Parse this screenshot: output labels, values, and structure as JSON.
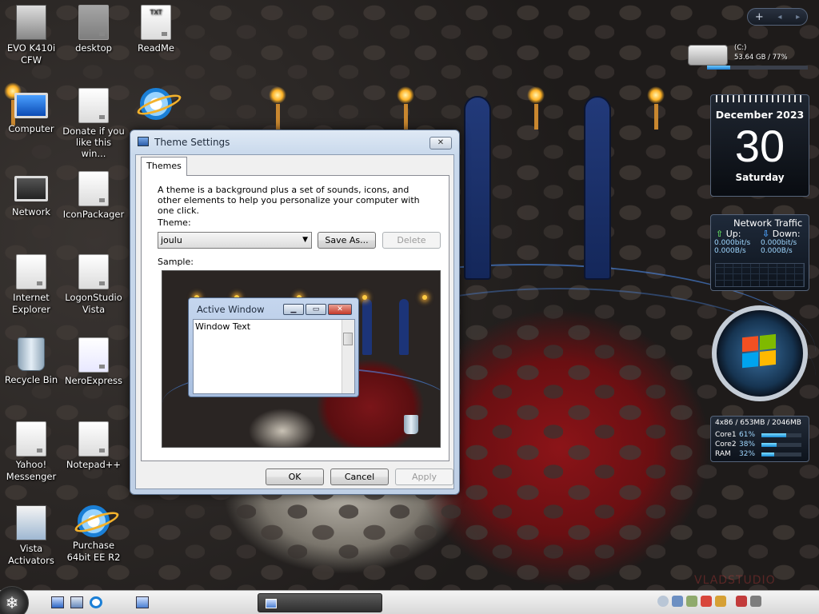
{
  "desktop_icons": [
    {
      "label": "EVO K410i\nCFW"
    },
    {
      "label": "desktop"
    },
    {
      "label": "ReadMe",
      "badge": "TXT"
    },
    {
      "label": "Computer"
    },
    {
      "label": "Donate if you like this win..."
    },
    {
      "label": "Network"
    },
    {
      "label": "IconPackager"
    },
    {
      "label": "Internet Explorer"
    },
    {
      "label": "LogonStudio Vista"
    },
    {
      "label": "Recycle Bin"
    },
    {
      "label": "NeroExpress"
    },
    {
      "label": "Yahoo! Messenger"
    },
    {
      "label": "Notepad++"
    },
    {
      "label": "Vista Activators"
    },
    {
      "label": "Purchase 64bit EE R2"
    }
  ],
  "gadget_toolbar": {
    "add": "+",
    "prev": "◂",
    "next": "▸"
  },
  "drive_gadget": {
    "name": "(C:)",
    "info": "53.64 GB / 77%",
    "used_fraction": 0.23
  },
  "calendar": {
    "month": "December 2023",
    "day": "30",
    "weekday": "Saturday"
  },
  "network": {
    "title": "Network Traffic",
    "up_label": "Up:",
    "down_label": "Down:",
    "up_bits": "0.000bit/s",
    "down_bits": "0.000bit/s",
    "up_bytes": "0.000B/s",
    "down_bytes": "0.000B/s"
  },
  "system_monitor": {
    "header": "4x86 / 653MB / 2046MB",
    "rows": [
      {
        "name": "Core1",
        "percent": "61%",
        "value": 0.61
      },
      {
        "name": "Core2",
        "percent": "38%",
        "value": 0.38
      },
      {
        "name": "RAM",
        "percent": "32%",
        "value": 0.32
      }
    ]
  },
  "dialog": {
    "title": "Theme Settings",
    "close": "✕",
    "tab": "Themes",
    "description": "A theme is a background plus a set of sounds, icons, and other elements to help you personalize your computer with one click.",
    "theme_label": "Theme:",
    "theme_value": "joulu",
    "save_as": "Save As...",
    "delete": "Delete",
    "sample_label": "Sample:",
    "preview": {
      "window_title": "Active Window",
      "window_text": "Window Text",
      "min": "▁",
      "max": "▭",
      "close": "✕"
    },
    "ok": "OK",
    "cancel": "Cancel",
    "apply": "Apply"
  },
  "taskbar": {
    "start_glyph": "❄"
  },
  "watermark": "VLADSTUDIO",
  "icons": [
    "snowflake-start-icon",
    "show-desktop-icon",
    "switch-windows-icon",
    "ie-icon",
    "theme-settings-icon",
    "gear-icon",
    "network-icon",
    "volume-icon",
    "security-icon"
  ],
  "colors": {
    "accent": "#1f7fd1",
    "dialog_frame": "#bfd0e6",
    "close_red": "#c4392a"
  }
}
